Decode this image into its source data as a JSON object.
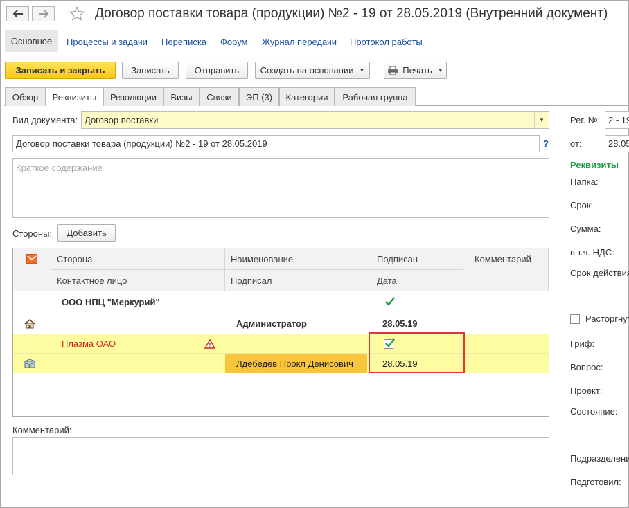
{
  "window": {
    "title": "Договор поставки товара (продукции) №2 - 19 от 28.05.2019 (Внутренний документ)"
  },
  "section_nav": [
    "Основное",
    "Процессы и задачи",
    "Переписка",
    "Форум",
    "Журнал передачи",
    "Протокол работы"
  ],
  "toolbar": {
    "save_close": "Записать и закрыть",
    "save": "Записать",
    "send": "Отправить",
    "create_based": "Создать на основании",
    "print": "Печать"
  },
  "tabs": [
    "Обзор",
    "Реквизиты",
    "Резолюции",
    "Визы",
    "Связи",
    "ЭП (3)",
    "Категории",
    "Рабочая группа"
  ],
  "active_tab": "Реквизиты",
  "form": {
    "doc_type_label": "Вид документа:",
    "doc_type_value": "Договор поставки",
    "title_value": "Договор поставки товара (продукции) №2 - 19 от 28.05.2019",
    "help": "?",
    "summary_placeholder": "Краткое содержание",
    "parties_label": "Стороны:",
    "add_button": "Добавить",
    "comment_label": "Комментарий:"
  },
  "table": {
    "headers_row1": [
      "Сторона",
      "Наименование",
      "Подписан",
      "Комментарий"
    ],
    "headers_row2": [
      "Контактное лицо",
      "Подписал",
      "Дата"
    ],
    "rows": [
      {
        "party": "ООО НПЦ \"Меркурий\"",
        "signed": true,
        "signer": "Администратор",
        "date": "28.05.19"
      },
      {
        "party": "Плазма ОАО",
        "signed": true,
        "signer": "Лдебедев Прокл Денисович",
        "date": "28.05.19"
      }
    ]
  },
  "right_panel": {
    "reg_no_label": "Рег. №:",
    "reg_no_value": "2 - 19",
    "date_label": "от:",
    "date_value": "28.05",
    "section_title": "Реквизиты",
    "folder": "Папка:",
    "term": "Срок:",
    "sum": "Сумма:",
    "vat": "в т.ч. НДС:",
    "validity": "Срок действия",
    "terminated": "Расторгнут",
    "stamp": "Гриф:",
    "question": "Вопрос:",
    "project": "Проект:",
    "state": "Состояние:",
    "department": "Подразделение",
    "prepared": "Подготовил:"
  },
  "colors": {
    "accent_yellow": "#f8c814",
    "row_highlight": "#fdfca0",
    "selected_cell": "#f9c53c",
    "highlight_frame": "#e8313a",
    "link": "#1a4f9c",
    "group_title": "#1f9a42"
  }
}
